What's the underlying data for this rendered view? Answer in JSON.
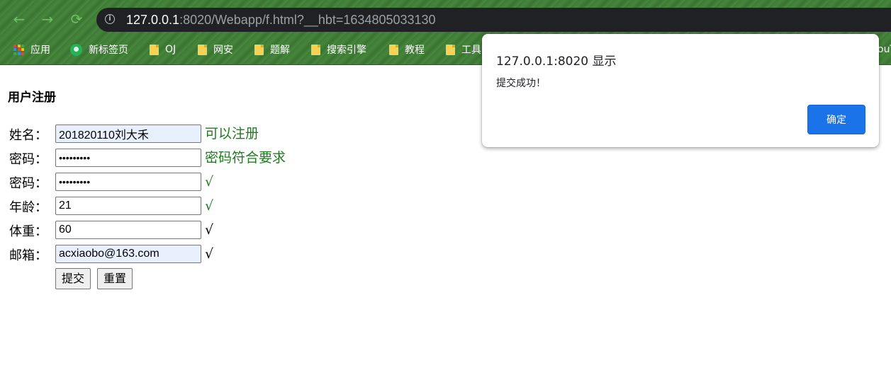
{
  "browser": {
    "url_host": "127.0.0.1",
    "url_rest": ":8020/Webapp/f.html?__hbt=1634805033130",
    "back_icon": "←",
    "forward_icon": "→",
    "reload_icon": "⟳",
    "info_icon": "i"
  },
  "bookmarks": [
    {
      "label": "应用",
      "icon": "apps-icon"
    },
    {
      "label": "新标签页",
      "icon": "globe-icon"
    },
    {
      "label": "OJ",
      "icon": "folder-icon"
    },
    {
      "label": "网安",
      "icon": "folder-icon"
    },
    {
      "label": "题解",
      "icon": "folder-icon"
    },
    {
      "label": "搜索引擎",
      "icon": "folder-icon"
    },
    {
      "label": "教程",
      "icon": "folder-icon"
    },
    {
      "label": "工具",
      "icon": "folder-icon"
    }
  ],
  "bookmark_overflow_text": "ouT",
  "page": {
    "title": "用户注册",
    "fields": [
      {
        "label": "姓名：",
        "value": "201820110刘大禾",
        "message": "可以注册",
        "message_color": "#1a7f1a"
      },
      {
        "label": "密码：",
        "value": "•••••••••",
        "message": "密码符合要求",
        "message_color": "#1a7f1a"
      },
      {
        "label": "密码：",
        "value": "•••••••••",
        "message": "√",
        "message_color": "#1a7f1a"
      },
      {
        "label": "年龄：",
        "value": "21",
        "message": "√",
        "message_color": "#1a7f1a"
      },
      {
        "label": "体重：",
        "value": "60",
        "message": "√",
        "message_color": "#000000"
      },
      {
        "label": "邮箱：",
        "value": "acxiaobo@163.com",
        "message": "√",
        "message_color": "#000000"
      }
    ],
    "submit_label": "提交",
    "reset_label": "重置"
  },
  "dialog": {
    "title": "127.0.0.1:8020 显示",
    "message": "提交成功！",
    "ok_label": "确定"
  },
  "colors": {
    "chrome_green": "#3d7a35",
    "ok_blue": "#1a73e8",
    "success_green": "#1a7f1a"
  }
}
